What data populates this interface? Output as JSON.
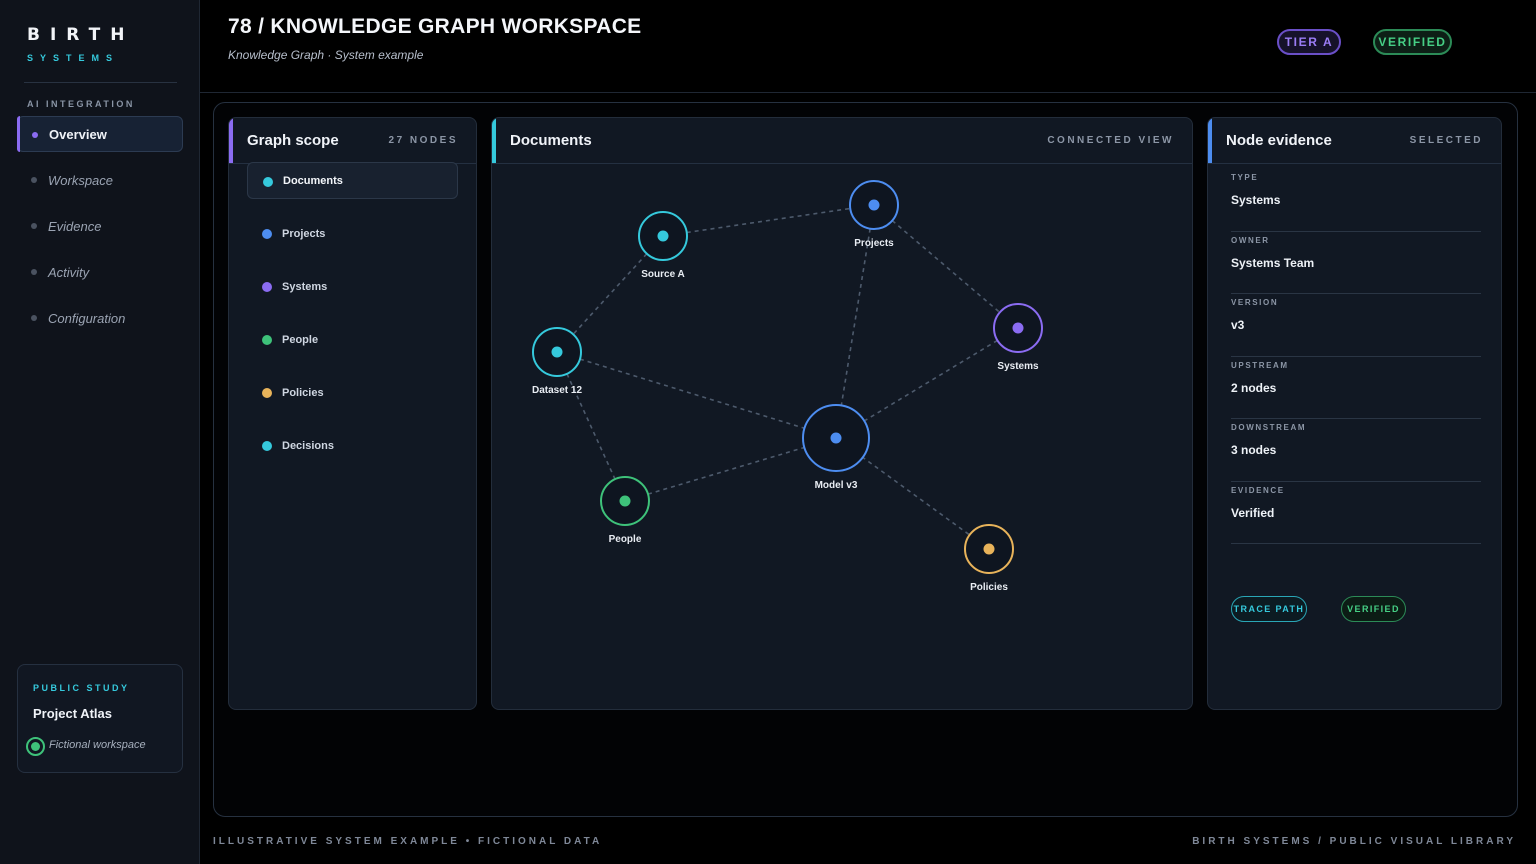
{
  "brand": {
    "name": "BIRTH",
    "sub": "SYSTEMS"
  },
  "sidebar": {
    "section_label": "AI INTEGRATION",
    "items": [
      {
        "label": "Overview",
        "active": true
      },
      {
        "label": "Workspace"
      },
      {
        "label": "Evidence"
      },
      {
        "label": "Activity"
      },
      {
        "label": "Configuration"
      }
    ],
    "study": {
      "label": "PUBLIC STUDY",
      "name": "Project Atlas",
      "note": "Fictional workspace"
    }
  },
  "header": {
    "title": "78 / KNOWLEDGE GRAPH WORKSPACE",
    "subtitle": "Knowledge Graph · System example",
    "badges": {
      "tier": "TIER A",
      "verified": "VERIFIED"
    }
  },
  "scope": {
    "title": "Graph scope",
    "meta": "27 NODES",
    "items": [
      {
        "label": "Documents",
        "color": "#35c9dc",
        "active": true
      },
      {
        "label": "Projects",
        "color": "#4d8df0"
      },
      {
        "label": "Systems",
        "color": "#8b6cf2"
      },
      {
        "label": "People",
        "color": "#3ec27a"
      },
      {
        "label": "Policies",
        "color": "#e8b35a"
      },
      {
        "label": "Decisions",
        "color": "#35c9dc"
      }
    ]
  },
  "documents": {
    "title": "Documents",
    "meta": "CONNECTED VIEW",
    "nodes": [
      {
        "id": "source",
        "label": "Source A",
        "color": "#35c9dc"
      },
      {
        "id": "projects",
        "label": "Projects",
        "color": "#4d8df0"
      },
      {
        "id": "systems",
        "label": "Systems",
        "color": "#8b6cf2"
      },
      {
        "id": "dataset",
        "label": "Dataset 12",
        "color": "#35c9dc"
      },
      {
        "id": "model",
        "label": "Model v3",
        "color": "#4d8df0"
      },
      {
        "id": "people",
        "label": "People",
        "color": "#3ec27a"
      },
      {
        "id": "policies",
        "label": "Policies",
        "color": "#e8b35a"
      }
    ],
    "edges": [
      [
        "source",
        "projects"
      ],
      [
        "source",
        "dataset"
      ],
      [
        "projects",
        "systems"
      ],
      [
        "projects",
        "model"
      ],
      [
        "systems",
        "model"
      ],
      [
        "dataset",
        "model"
      ],
      [
        "dataset",
        "people"
      ],
      [
        "people",
        "model"
      ],
      [
        "model",
        "policies"
      ]
    ]
  },
  "evidence": {
    "title": "Node evidence",
    "meta": "SELECTED",
    "fields": [
      {
        "label": "TYPE",
        "value": "Systems"
      },
      {
        "label": "OWNER",
        "value": "Systems Team"
      },
      {
        "label": "VERSION",
        "value": "v3"
      },
      {
        "label": "UPSTREAM",
        "value": "2 nodes"
      },
      {
        "label": "DOWNSTREAM",
        "value": "3 nodes"
      },
      {
        "label": "EVIDENCE",
        "value": "Verified"
      }
    ],
    "buttons": {
      "trace": "TRACE PATH",
      "verified": "VERIFIED"
    }
  },
  "footer": {
    "left": "ILLUSTRATIVE SYSTEM EXAMPLE  •  FICTIONAL DATA",
    "right": "BIRTH SYSTEMS / PUBLIC VISUAL LIBRARY"
  }
}
